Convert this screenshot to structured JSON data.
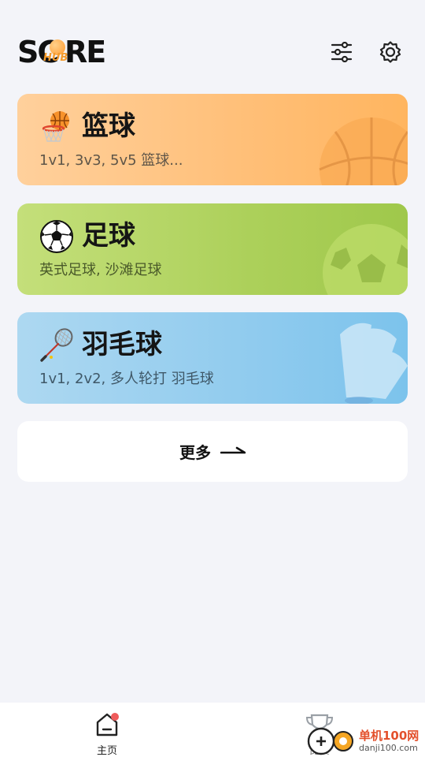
{
  "header": {
    "logo": {
      "part1": "SC",
      "part2": "RE",
      "badge": "HUB"
    }
  },
  "sports": [
    {
      "title": "篮球",
      "subtitle": "1v1, 3v3, 5v5 篮球..."
    },
    {
      "title": "足球",
      "subtitle": "英式足球, 沙滩足球"
    },
    {
      "title": "羽毛球",
      "subtitle": "1v1, 2v2, 多人轮打 羽毛球"
    }
  ],
  "more": {
    "label": "更多"
  },
  "tabbar": {
    "home_label": "主页",
    "match_label": "比赛"
  },
  "watermark": {
    "line1": "单机100网",
    "line2": "danji100.com"
  }
}
